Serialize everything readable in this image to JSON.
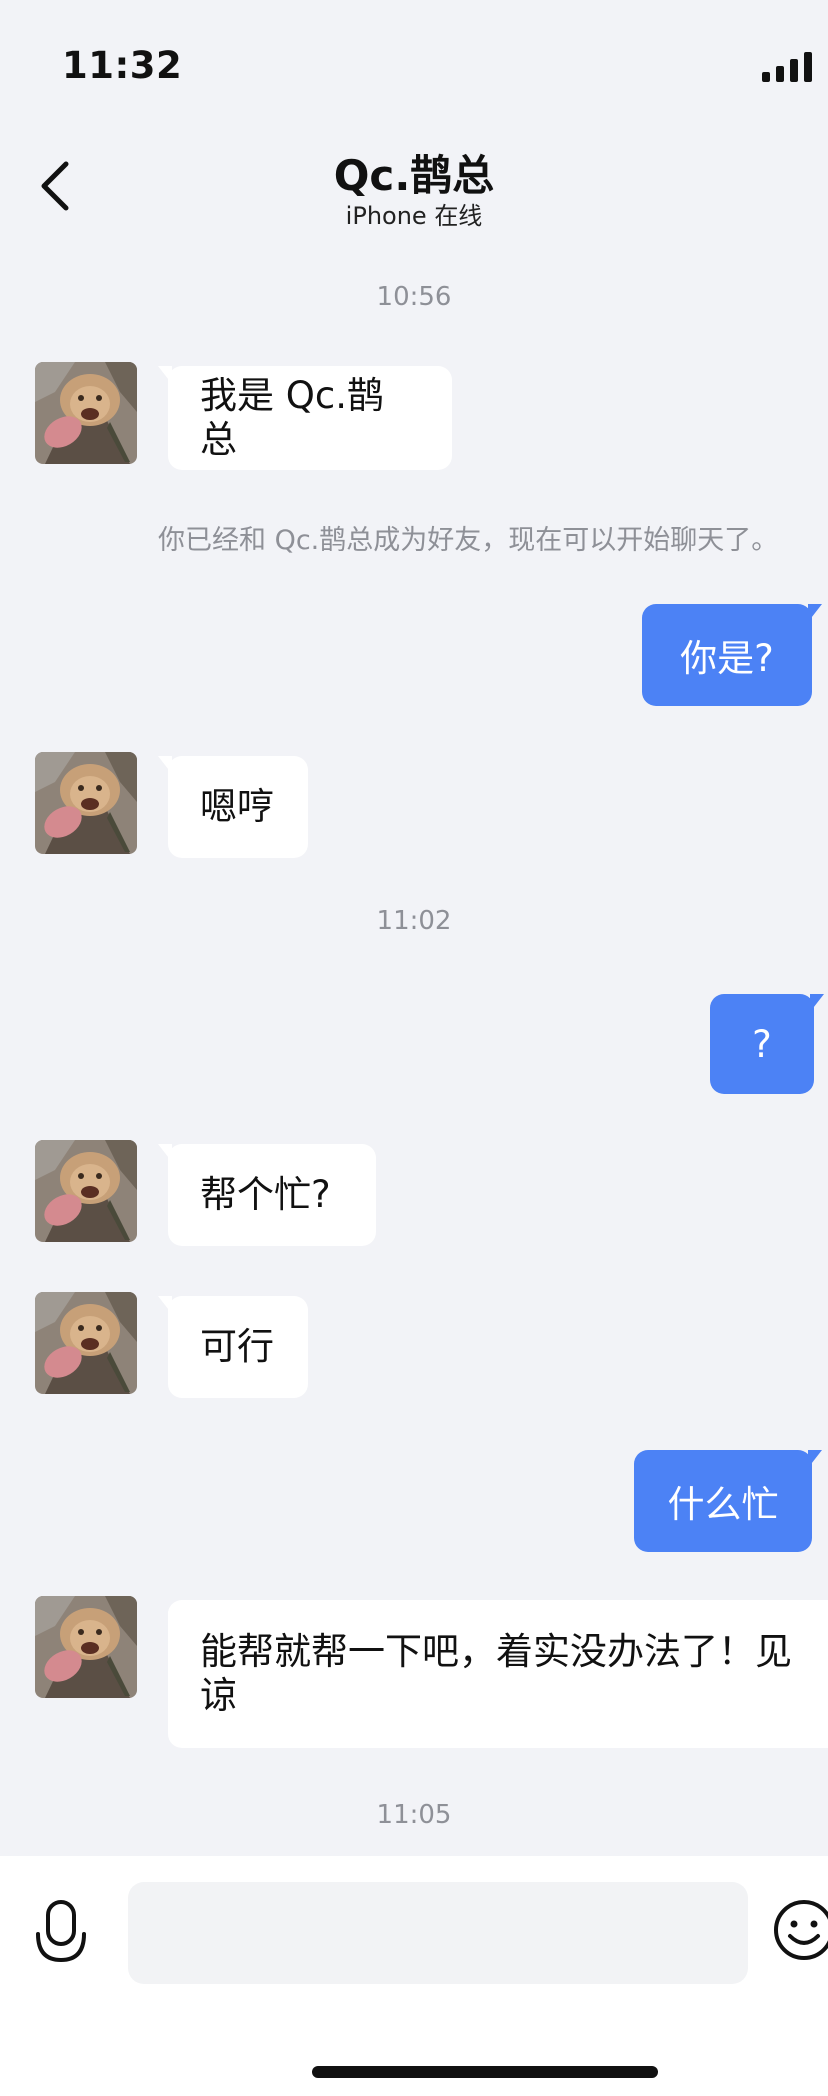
{
  "status_bar": {
    "time": "11:32"
  },
  "header": {
    "title": "Qc.鹊总",
    "subtitle": "iPhone 在线"
  },
  "messages": [
    {
      "type": "time",
      "text": "10:56"
    },
    {
      "type": "incoming",
      "text": "我是 Qc.鹊总"
    },
    {
      "type": "system",
      "text": "你已经和 Qc.鹊总成为好友，现在可以开始聊天了。"
    },
    {
      "type": "outgoing",
      "text": "你是?"
    },
    {
      "type": "incoming",
      "text": "嗯哼"
    },
    {
      "type": "time",
      "text": "11:02"
    },
    {
      "type": "outgoing",
      "text": "?"
    },
    {
      "type": "incoming",
      "text": "帮个忙?"
    },
    {
      "type": "incoming",
      "text": "可行"
    },
    {
      "type": "outgoing",
      "text": "什么忙"
    },
    {
      "type": "incoming",
      "text": "能帮就帮一下吧，着实没办法了！见谅"
    },
    {
      "type": "time",
      "text": "11:05"
    }
  ],
  "composer": {
    "value": ""
  },
  "icons": {
    "back": "chevron-left-icon",
    "signal": "cellular-signal-icon",
    "voice": "microphone-icon",
    "emoji": "smiley-icon"
  },
  "colors": {
    "outgoing_bubble": "#4c82f5",
    "background": "#f2f3f7"
  }
}
